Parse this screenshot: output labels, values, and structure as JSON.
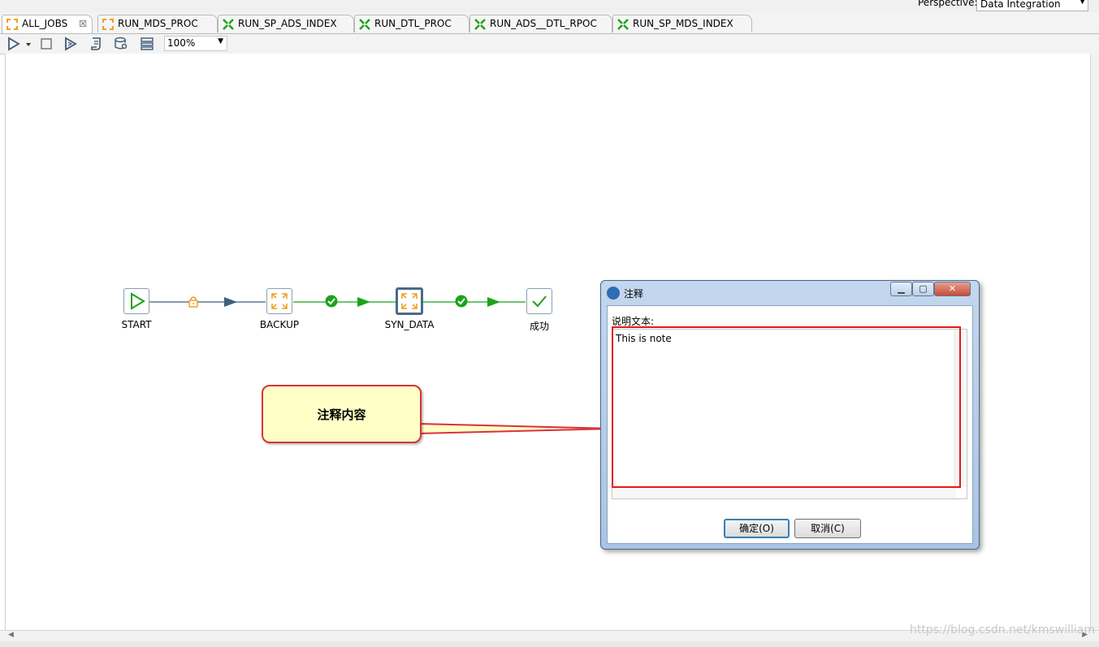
{
  "perspective": {
    "label": "Perspective:",
    "value": "Data Integration"
  },
  "tabs": [
    {
      "label": "ALL_JOBS",
      "close": "☒",
      "icon": "job-icon-orange",
      "active": true
    },
    {
      "label": "RUN_MDS_PROC",
      "icon": "job-icon-orange"
    },
    {
      "label": "RUN_SP_ADS_INDEX",
      "icon": "transform-icon-green"
    },
    {
      "label": "RUN_DTL_PROC",
      "icon": "transform-icon-green"
    },
    {
      "label": "RUN_ADS__DTL_RPOC",
      "icon": "transform-icon-green"
    },
    {
      "label": "RUN_SP_MDS_INDEX",
      "icon": "transform-icon-green"
    }
  ],
  "toolbar": {
    "zoom": "100%"
  },
  "workflow": {
    "nodes": [
      {
        "label": "START",
        "icon": "play-icon"
      },
      {
        "label": "BACKUP",
        "icon": "job-arrows-icon"
      },
      {
        "label": "SYN_DATA",
        "icon": "job-arrows-icon",
        "selected": true
      },
      {
        "label": "成功",
        "icon": "check-icon"
      }
    ],
    "hops": [
      {
        "icon": "lock-icon",
        "color": "#f0a020"
      },
      {
        "icon": "success-icon",
        "color": "#1aa41a"
      },
      {
        "icon": "success-icon",
        "color": "#1aa41a"
      }
    ]
  },
  "callout": {
    "text": "注释内容"
  },
  "dialog": {
    "title": "注释",
    "label": "说明文本:",
    "text": "This is note",
    "ok": "确定(O)",
    "cancel": "取消(C)"
  },
  "watermark": "https://blog.csdn.net/kmswilliam",
  "colors": {
    "accent_red": "#e11a1a",
    "callout_bg": "#ffffc6",
    "hop_blue": "#3f5f7c",
    "hop_green": "#1aa41a"
  }
}
